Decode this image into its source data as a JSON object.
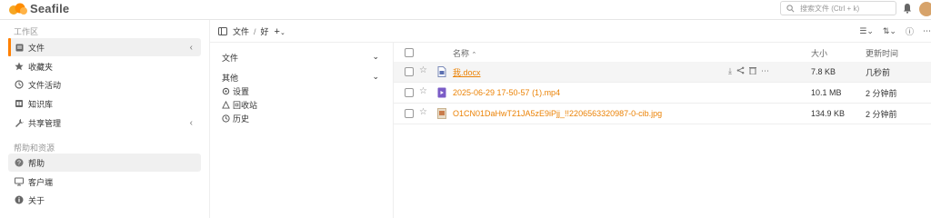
{
  "app": {
    "logo_text": "Seafile"
  },
  "search": {
    "placeholder": "搜索文件 (Ctrl + k)"
  },
  "sidebar": {
    "workspace_title": "工作区",
    "items": [
      {
        "label": "文件",
        "icon": "file-icon"
      },
      {
        "label": "收藏夹",
        "icon": "star-icon"
      },
      {
        "label": "文件活动",
        "icon": "history-icon"
      },
      {
        "label": "知识库",
        "icon": "wiki-icon"
      },
      {
        "label": "共享管理",
        "icon": "wrench-icon"
      }
    ],
    "help_title": "帮助和资源",
    "help_items": [
      {
        "label": "帮助",
        "icon": "question-icon"
      },
      {
        "label": "客户端",
        "icon": "monitor-icon"
      },
      {
        "label": "关于",
        "icon": "info-icon"
      }
    ]
  },
  "breadcrumb": {
    "root": "文件",
    "separator": "/",
    "current": "好"
  },
  "tree": {
    "files_label": "文件",
    "other_label": "其他",
    "items": [
      {
        "label": "设置",
        "icon": "settings-icon"
      },
      {
        "label": "回收站",
        "icon": "trash-icon"
      },
      {
        "label": "历史",
        "icon": "history-icon"
      }
    ]
  },
  "table": {
    "headers": {
      "name": "名称",
      "size": "大小",
      "modified": "更新时间"
    },
    "rows": [
      {
        "name": "我.docx",
        "size": "7.8 KB",
        "modified": "几秒前",
        "type": "docx"
      },
      {
        "name": "2025-06-29 17-50-57 (1).mp4",
        "size": "10.1 MB",
        "modified": "2 分钟前",
        "type": "video"
      },
      {
        "name": "O1CN01DaHwT21JA5zE9iPjj_!!2206563320987-0-cib.jpg",
        "size": "134.9 KB",
        "modified": "2 分钟前",
        "type": "image"
      }
    ]
  },
  "colors": {
    "accent": "#ff8000",
    "file_link": "#eb8205"
  }
}
